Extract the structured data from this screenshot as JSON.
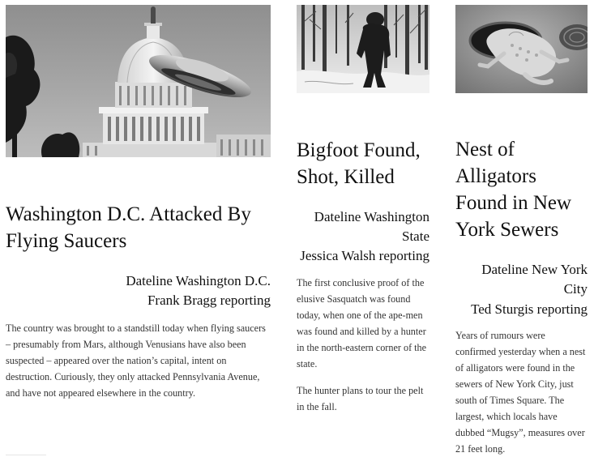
{
  "articles": [
    {
      "image": "photo of the U.S. Capitol dome with a flying saucer",
      "headline": "Washington D.C. Attacked By Flying Saucers",
      "dateline": "Dateline Washington D.C.",
      "byline": "Frank Bragg reporting",
      "paragraphs": [
        "The country was brought to a standstill today when flying saucers – presumably from Mars, although Venusians have also been suspected – appeared over the nation’s capital, intent on destruction. Curiously, they only attacked Pennsylvania Avenue, and have not appeared elsewhere in the country."
      ]
    },
    {
      "image": "photo of Bigfoot walking through a snowy forest",
      "headline": "Bigfoot Found, Shot, Killed",
      "dateline": "Dateline Washington State",
      "byline": "Jessica Walsh reporting",
      "paragraphs": [
        "The first conclusive proof of the elusive Sasquatch was found today, when one of the ape-men was found and killed by a hunter in the north-eastern corner of the state.",
        "The hunter plans to tour the pelt in the fall."
      ]
    },
    {
      "image": "photo of an alligator emerging from a sewer manhole",
      "headline": "Nest of Alligators Found in New York Sewers",
      "dateline": "Dateline New York City",
      "byline": "Ted Sturgis reporting",
      "paragraphs": [
        "Years of rumours were confirmed yesterday when a nest of alligators were found in the sewers of New York City, just south of Times Square. The largest, which locals have dubbed “Mugsy”, measures over 21 feet long."
      ]
    }
  ]
}
